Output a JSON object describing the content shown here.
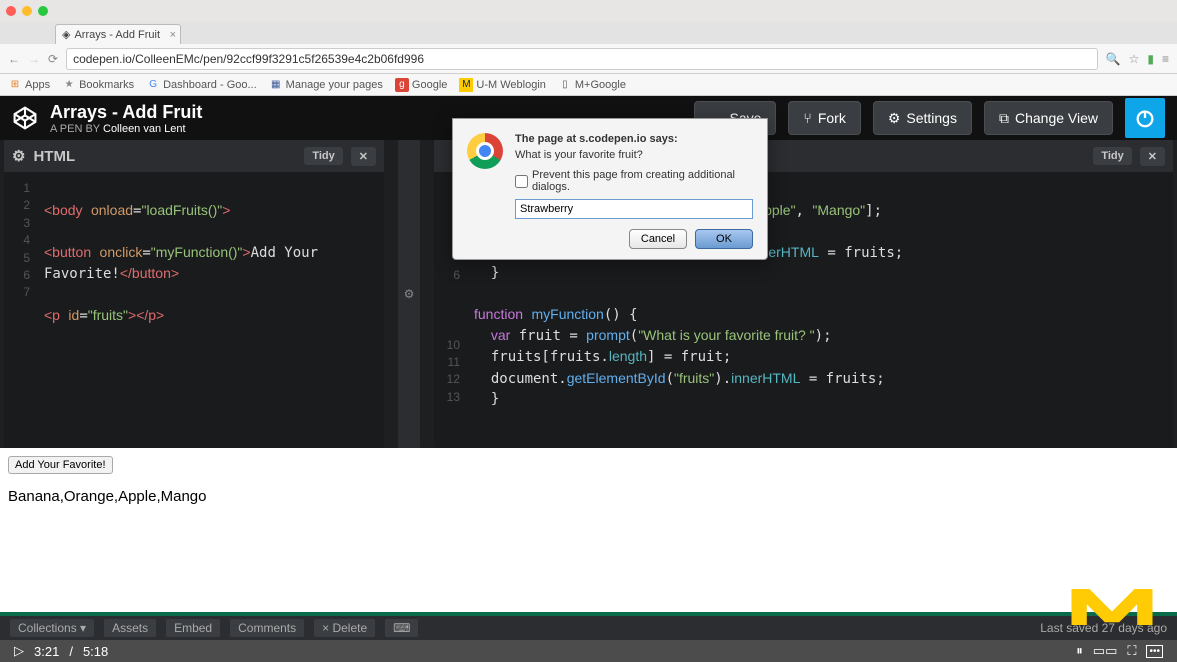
{
  "mac": {
    "red": "#ff5f57",
    "yellow": "#febc2e",
    "green": "#28c840"
  },
  "browser": {
    "tab_title": "Arrays - Add Fruit",
    "url": "codepen.io/ColleenEMc/pen/92ccf99f3291c5f26539e4c2b06fd996",
    "bookmarks": [
      {
        "label": "Apps",
        "icon": "⊞",
        "color": "#e67e22"
      },
      {
        "label": "Bookmarks",
        "icon": "★",
        "color": "#888"
      },
      {
        "label": "Dashboard - Goo...",
        "icon": "G",
        "color": "#4285f4"
      },
      {
        "label": "Manage your pages",
        "icon": "▦",
        "color": "#3b5998"
      },
      {
        "label": "Google",
        "icon": "g",
        "color": "#db4437"
      },
      {
        "label": "U-M Weblogin",
        "icon": "M",
        "color": "#ffcb05"
      },
      {
        "label": "M+Google",
        "icon": "▯",
        "color": "#888"
      }
    ]
  },
  "codepen": {
    "title": "Arrays - Add Fruit",
    "pen_by": "A PEN BY",
    "author": "Colleen van Lent",
    "buttons": {
      "save": "Save",
      "fork": "Fork",
      "settings": "Settings",
      "change_view": "Change View"
    },
    "panes": {
      "html": {
        "label": "HTML",
        "tidy": "Tidy"
      },
      "js": {
        "label": "",
        "tidy": "Tidy"
      }
    },
    "footer": {
      "collections": "Collections",
      "assets": "Assets",
      "embed": "Embed",
      "comments": "Comments",
      "delete": "× Delete",
      "last_saved": "Last saved 27 days ago"
    }
  },
  "code_html": {
    "l1": "<body onload=\"loadFruits()\">",
    "l2a": "<button onclick=\"myFunction()\">",
    "l2b": "Add Your Favorite!",
    "l2c": "</button>",
    "l3": "<p id=\"fruits\"></p>"
  },
  "code_js": {
    "l1": "\"Orange\", \"Apple\", \"Mango\"];",
    "l3": "d(\"fruits\").innerHTML = fruits;",
    "l4": "}",
    "l6": "function myFunction() {",
    "l7": "  var fruit = prompt(\"What is your favorite fruit? \");",
    "l8": "  fruits[fruits.length] = fruit;",
    "l9": "  document.getElementById(\"fruits\").innerHTML = fruits;",
    "l10": "  }"
  },
  "preview": {
    "button": "Add Your Favorite!",
    "fruits": "Banana,Orange,Apple,Mango"
  },
  "dialog": {
    "title": "The page at s.codepen.io says:",
    "message": "What is your favorite fruit?",
    "prevent": "Prevent this page from creating additional dialogs.",
    "input_value": "Strawberry",
    "cancel": "Cancel",
    "ok": "OK"
  },
  "video": {
    "current": "3:21",
    "sep": " / ",
    "total": "5:18"
  }
}
